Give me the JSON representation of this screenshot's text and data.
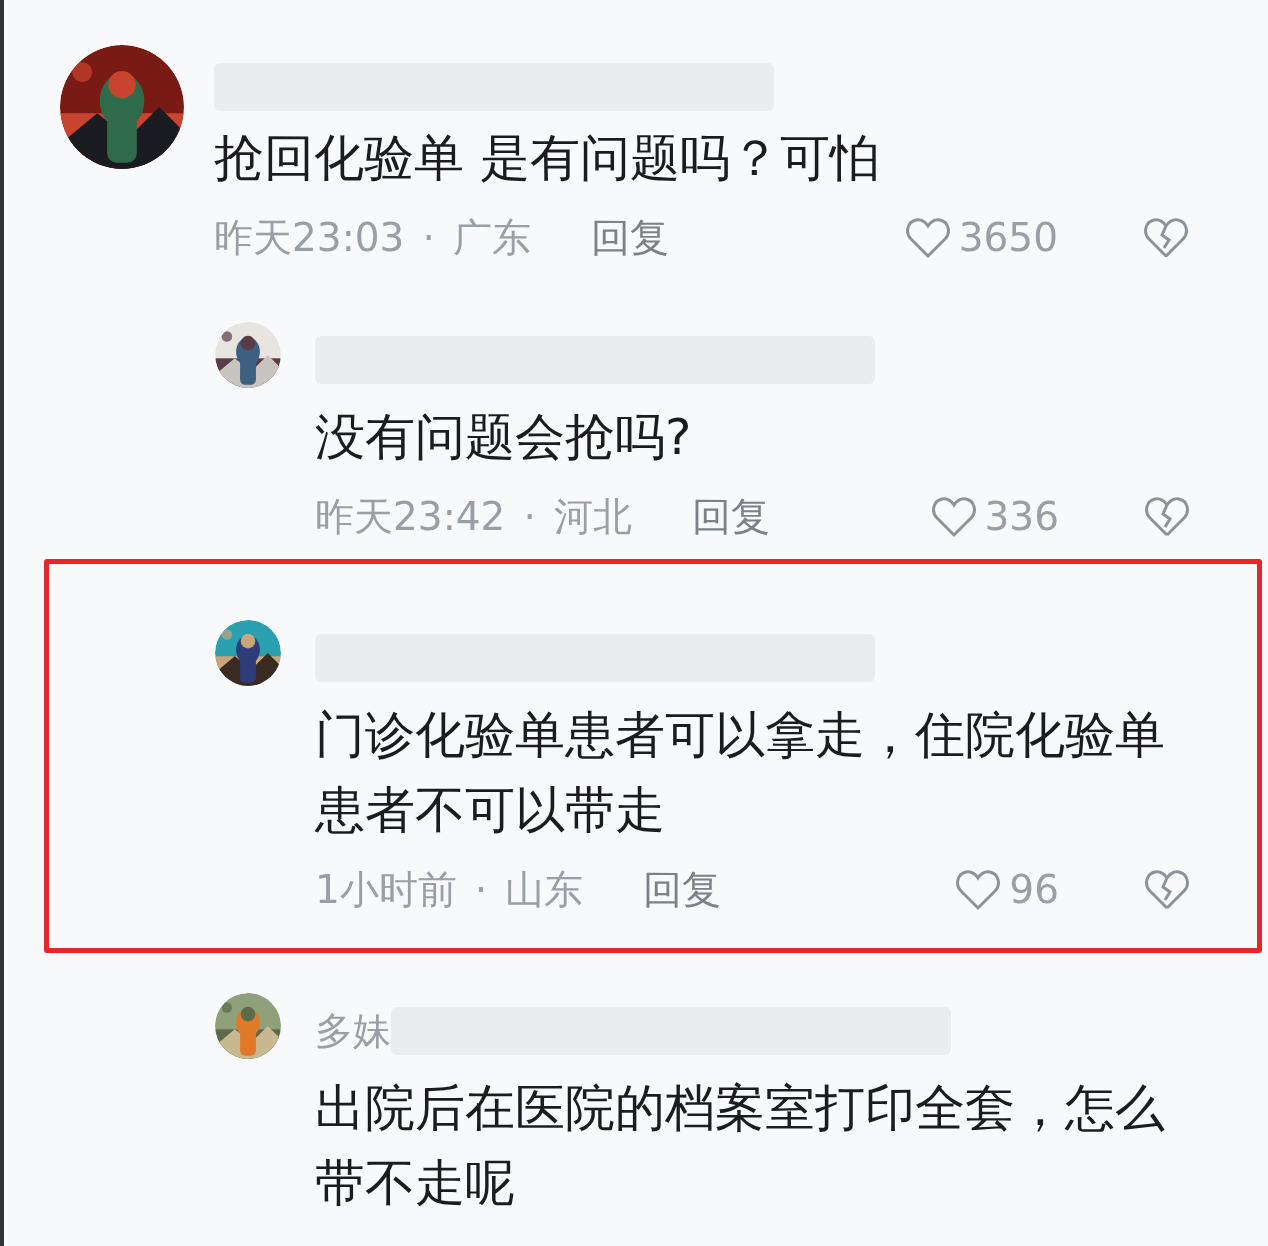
{
  "comments": [
    {
      "kind": "top",
      "highlighted": false,
      "text": "抢回化验单 是有问题吗？可怕",
      "time": "昨天23:03",
      "separator": "·",
      "location": "广东",
      "reply": "回复",
      "likes": "3650"
    },
    {
      "kind": "reply",
      "highlighted": false,
      "text": "没有问题会抢吗?",
      "time": "昨天23:42",
      "separator": "·",
      "location": "河北",
      "reply": "回复",
      "likes": "336"
    },
    {
      "kind": "reply",
      "highlighted": true,
      "text": "门诊化验单患者可以拿走，住院化验单患者不可以带走",
      "time": "1小时前",
      "separator": "·",
      "location": "山东",
      "reply": "回复",
      "likes": "96"
    },
    {
      "kind": "reply",
      "highlighted": false,
      "author": "多妹",
      "text": "出院后在医院的档案室打印全套，怎么带不走呢"
    }
  ]
}
